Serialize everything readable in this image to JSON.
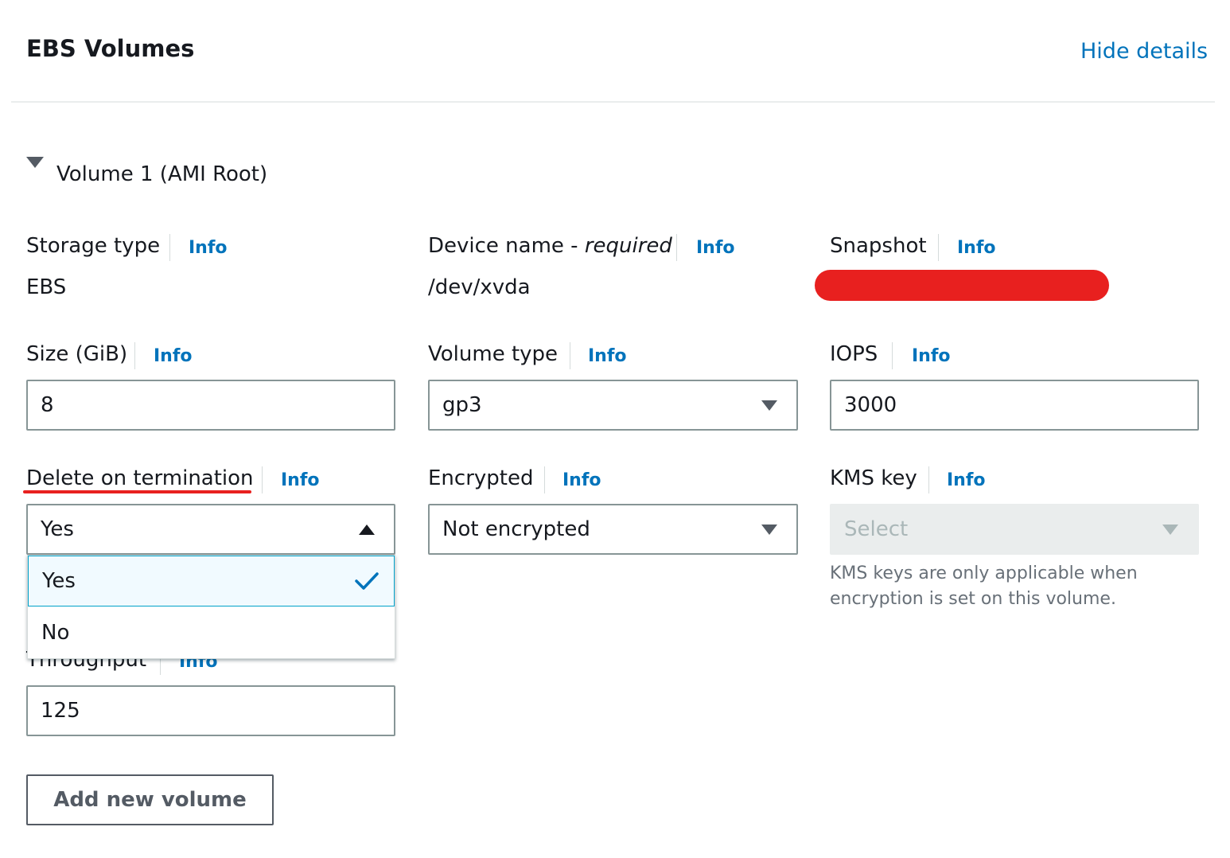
{
  "header": {
    "title": "EBS Volumes",
    "hide_details": "Hide details"
  },
  "volume": {
    "title": "Volume 1 (AMI Root)"
  },
  "fields": {
    "storage_type": {
      "label": "Storage type",
      "info": "Info",
      "value": "EBS"
    },
    "device_name": {
      "label": "Device name - ",
      "label_em": "required",
      "info": "Info",
      "value": "/dev/xvda"
    },
    "snapshot": {
      "label": "Snapshot",
      "info": "Info"
    },
    "size": {
      "label": "Size (GiB)",
      "info": "Info",
      "value": "8"
    },
    "volume_type": {
      "label": "Volume type",
      "info": "Info",
      "value": "gp3"
    },
    "iops": {
      "label": "IOPS",
      "info": "Info",
      "value": "3000"
    },
    "delete_on_termination": {
      "label": "Delete on termination",
      "info": "Info",
      "value": "Yes",
      "options": [
        "Yes",
        "No"
      ]
    },
    "encrypted": {
      "label": "Encrypted",
      "info": "Info",
      "value": "Not encrypted"
    },
    "kms_key": {
      "label": "KMS key",
      "info": "Info",
      "placeholder": "Select",
      "hint": "KMS keys are only applicable when encryption is set on this volume."
    },
    "throughput": {
      "label": "Throughput",
      "info": "Info",
      "value": "125"
    }
  },
  "actions": {
    "add_volume": "Add new volume"
  },
  "colors": {
    "link": "#0073bb",
    "redaction": "#e8201f",
    "selected_bg": "#f1faff"
  }
}
